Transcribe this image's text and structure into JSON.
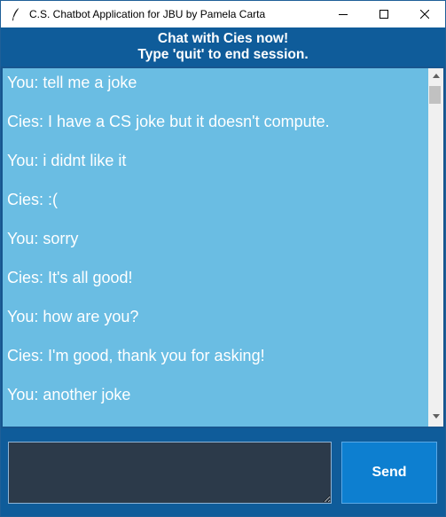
{
  "window": {
    "title": "C.S. Chatbot Application for JBU by Pamela Carta",
    "app_icon": "feather-icon",
    "controls": [
      "minimize-icon",
      "maximize-icon",
      "close-icon"
    ]
  },
  "header": {
    "line1": "Chat with Cies now!",
    "line2": "Type 'quit' to end session."
  },
  "chat": {
    "messages": [
      "You: tell me a joke",
      "Cies: I have a CS joke but it doesn't compute.",
      "You: i didnt like it",
      "Cies: :(",
      "You: sorry",
      "Cies: It's all good!",
      "You: how are you?",
      "Cies: I'm good, thank you for asking!",
      "You: another joke"
    ]
  },
  "input": {
    "value": "",
    "send_label": "Send"
  },
  "colors": {
    "header_bg": "#0f5c9a",
    "chat_bg": "#6abde3",
    "input_bg": "#2c3a4a",
    "send_bg": "#0d7fd0",
    "text": "#ffffff"
  }
}
